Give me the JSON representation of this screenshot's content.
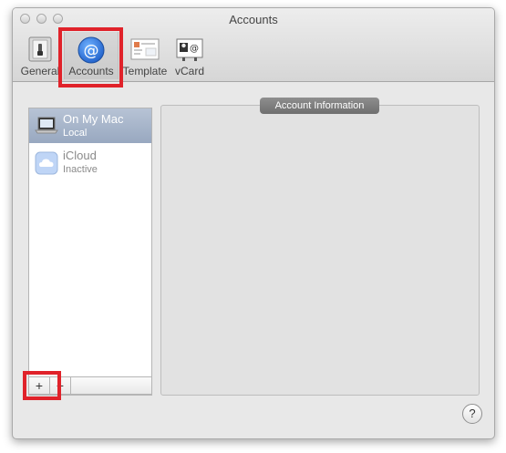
{
  "window": {
    "title": "Accounts"
  },
  "toolbar": {
    "items": [
      {
        "label": "General",
        "icon": "general-switch-icon"
      },
      {
        "label": "Accounts",
        "icon": "at-sign-icon"
      },
      {
        "label": "Template",
        "icon": "template-icon"
      },
      {
        "label": "vCard",
        "icon": "vcard-icon"
      }
    ],
    "selected": "Accounts"
  },
  "accounts": [
    {
      "name": "On My Mac",
      "subtitle": "Local",
      "icon": "laptop-icon",
      "selected": true
    },
    {
      "name": "iCloud",
      "subtitle": "Inactive",
      "icon": "cloud-icon",
      "selected": false
    }
  ],
  "list_controls": {
    "add": "+",
    "remove": "−"
  },
  "panel": {
    "title": "Account Information"
  },
  "help": {
    "label": "?"
  },
  "colors": {
    "highlight": "#e0222a",
    "accent": "#3b7bdc",
    "selection": "#a9b7cc"
  }
}
